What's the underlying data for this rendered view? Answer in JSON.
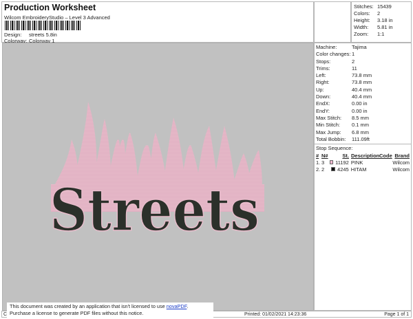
{
  "header": {
    "title": "Production Worksheet",
    "subtitle": "Wilcom EmbroideryStudio – Level 3 Advanced",
    "design_label": "Design:",
    "design": "streets 5.8in",
    "colorway_label": "Colorway:",
    "colorway": "Colorway 1"
  },
  "stats": [
    {
      "k": "Stitches:",
      "v": "15439"
    },
    {
      "k": "Colors:",
      "v": "2"
    },
    {
      "k": "Height:",
      "v": "3.18 in"
    },
    {
      "k": "Width:",
      "v": "5.81 in"
    },
    {
      "k": "Zoom:",
      "v": "1:1"
    }
  ],
  "info": [
    {
      "k": "Machine:",
      "v": "Tajima"
    },
    {
      "k": "Color changes:",
      "v": "1"
    },
    {
      "k": "Stops:",
      "v": "2"
    },
    {
      "k": "Trims:",
      "v": "11"
    },
    {
      "k": "Left:",
      "v": "73.8 mm"
    },
    {
      "k": "Right:",
      "v": "73.8 mm"
    },
    {
      "k": "Up:",
      "v": "40.4 mm"
    },
    {
      "k": "Down:",
      "v": "40.4 mm"
    },
    {
      "k": "EndX:",
      "v": "0.00 in"
    },
    {
      "k": "EndY:",
      "v": "0.00 in"
    },
    {
      "k": "Max Stitch:",
      "v": "8.5 mm"
    },
    {
      "k": "Min Stitch:",
      "v": "0.1 mm"
    },
    {
      "k": "Max Jump:",
      "v": "6.8 mm"
    },
    {
      "k": "Total Bobbin:",
      "v": "111.09ft"
    }
  ],
  "stop_sequence": {
    "title": "Stop Sequence:",
    "headers": [
      "#",
      "N#",
      "St.",
      "Description",
      "Code",
      "Brand"
    ],
    "rows": [
      {
        "n": "1.",
        "nn": "3",
        "color": "#f2b8d0",
        "st": "11192",
        "desc": "PINK",
        "code": "",
        "brand": "Wilcom"
      },
      {
        "n": "2.",
        "nn": "2",
        "color": "#111111",
        "st": "4245",
        "desc": "HITAM",
        "code": "",
        "brand": "Wilcom"
      }
    ]
  },
  "design_text": "Streets",
  "footer": {
    "left": "Cr",
    "printed": "Printed: 01/02/2021 14:23:36",
    "page": "Page 1 of 1"
  },
  "notice": {
    "line1": "This document was created by an application that isn't licensed to use ",
    "link": "novaPDF",
    "line1_end": ".",
    "line2": "Purchase a license to generate PDF files without this notice."
  },
  "colors": {
    "flame": "#e8bccb",
    "text": "#2b302a"
  }
}
